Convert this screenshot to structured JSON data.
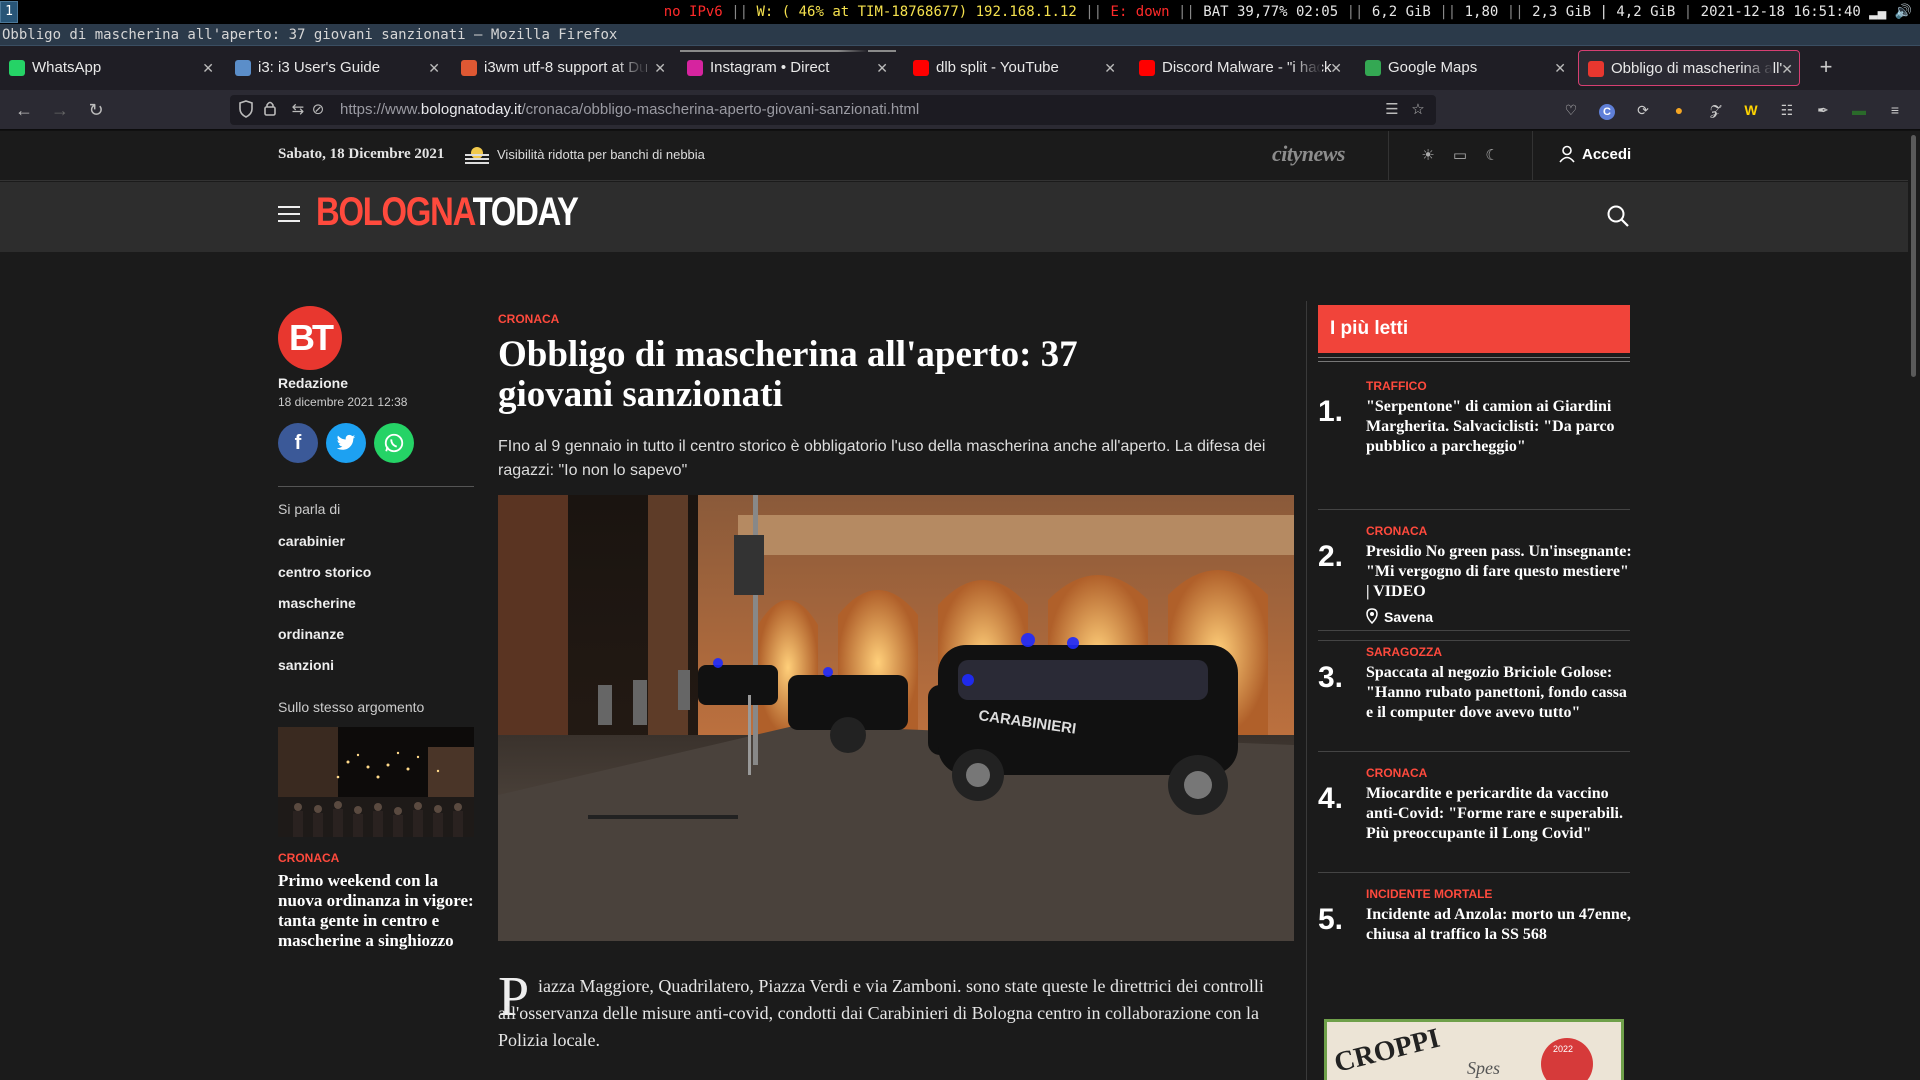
{
  "i3": {
    "workspace": "1",
    "status": {
      "ipv6": "no IPv6",
      "wifi": "W: ( 46% at TIM-18768677) 192.168.1.12",
      "eth": "E: down",
      "bat": "BAT 39,77% 02:05",
      "disk": "6,2 GiB",
      "load": "1,80",
      "mem": "2,3 GiB | 4,2 GiB",
      "time": "2021-12-18 16:51:40"
    }
  },
  "window_title": "Obbligo di mascherina all'aperto: 37 giovani sanzionati — Mozilla Firefox",
  "tabs": [
    {
      "label": "WhatsApp",
      "favicon_color": "#25d366",
      "icon": "whatsapp-icon"
    },
    {
      "label": "i3: i3 User's Guide",
      "favicon_color": "#5b8ec9",
      "icon": "i3-icon"
    },
    {
      "label": "i3wm utf-8 support at Du",
      "favicon_color": "#de5833",
      "icon": "duckduckgo-icon"
    },
    {
      "label": "Instagram • Direct",
      "favicon_color": "#d6249f",
      "icon": "instagram-icon"
    },
    {
      "label": "dlb split - YouTube",
      "favicon_color": "#ff0000",
      "icon": "youtube-icon"
    },
    {
      "label": "Discord Malware - \"i hack",
      "favicon_color": "#ff0000",
      "icon": "youtube-icon"
    },
    {
      "label": "Google Maps",
      "favicon_color": "#34a853",
      "icon": "google-maps-icon"
    },
    {
      "label": "Obbligo di mascherina all'",
      "favicon_color": "#e8372f",
      "icon": "bolognatoday-icon"
    }
  ],
  "url": {
    "prefix": "https://www.",
    "domain": "bolognatoday.it",
    "path": "/cronaca/obbligo-mascherina-aperto-giovani-sanzionati.html"
  },
  "site": {
    "date": "Sabato, 18 Dicembre 2021",
    "weather": "Visibilità ridotta per banchi di nebbia",
    "network": "citynews",
    "login": "Accedi",
    "logo_a": "BOLOGNA",
    "logo_b": "TODAY",
    "brand_color": "#ff4a3d"
  },
  "sidebar": {
    "avatar": "BT",
    "author": "Redazione",
    "published": "18 dicembre 2021 12:38",
    "tags_heading": "Si parla di",
    "tags": [
      "carabinier",
      "centro storico",
      "mascherine",
      "ordinanze",
      "sanzioni"
    ],
    "related_heading": "Sullo stesso argomento",
    "related": {
      "category": "CRONACA",
      "title": "Primo weekend con la nuova ordinanza in vigore: tanta gente in centro e mascherine a singhiozzo"
    }
  },
  "article": {
    "category": "CRONACA",
    "title": "Obbligo di mascherina all'aperto: 37 giovani sanzionati",
    "subtitle": "FIno al 9 gennaio in tutto il centro storico è obbligatorio l'uso della mascherina anche all'aperto. La difesa dei ragazzi: \"Io non lo sapevo\"",
    "dropcap": "P",
    "body": "iazza Maggiore, Quadrilatero, Piazza Verdi e via Zamboni. sono state queste le direttrici dei controlli all'osservanza delle misure anti-covid, condotti dai Carabinieri di Bologna centro in collaborazione con la Polizia locale.",
    "car_text": "CARABINIERI"
  },
  "most_read": {
    "heading": "I più letti",
    "items": [
      {
        "num": "1.",
        "category": "TRAFFICO",
        "title": "\"Serpentone\" di camion ai Giardini Margherita. Salvaciclisti: \"Da parco pubblico a parcheggio\"",
        "location": "Savena"
      },
      {
        "num": "2.",
        "category": "CRONACA",
        "title": "Presidio No green pass. Un'insegnante: \"Mi vergogno di fare questo mestiere\" | VIDEO"
      },
      {
        "num": "3.",
        "category": "SARAGOZZA",
        "title": "Spaccata al negozio Briciole Golose: \"Hanno rubato panettoni, fondo cassa e il computer dove avevo tutto\""
      },
      {
        "num": "4.",
        "category": "CRONACA",
        "title": "Miocardite e pericardite da vaccino anti-Covid: \"Forme rare e superabili. Più preoccupante il Long Covid\""
      },
      {
        "num": "5.",
        "category": "INCIDENTE MORTALE",
        "title": "Incidente ad Anzola: morto un 47enne, chiusa al traffico la SS 568"
      }
    ]
  },
  "ad": {
    "text_a": "CROPPI",
    "text_b": "2022"
  }
}
